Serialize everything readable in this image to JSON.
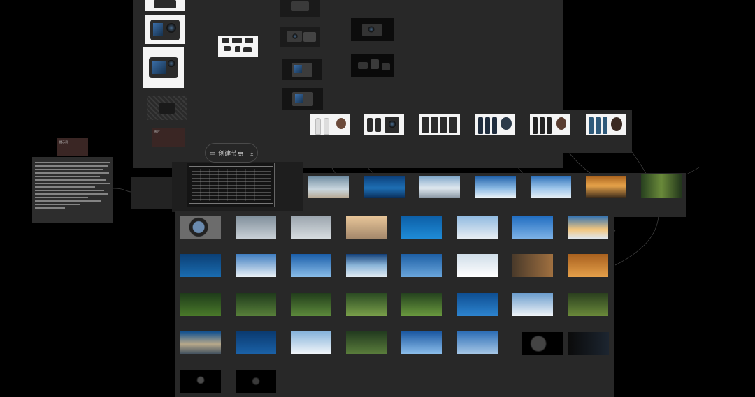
{
  "canvas": {
    "create_node_label": "创建节点",
    "create_node_icon": "node-add-icon",
    "download_icon": "download-icon",
    "note_label_1": "提示词",
    "note_label_2": "图片"
  },
  "gallery": {
    "rows": [
      [
        "camera-lens",
        "camera-stand",
        "camera-front",
        "camera-desert",
        "diver",
        "skier-goggles",
        "skydiver",
        "sunrise-clouds"
      ],
      [
        "diver-underwater",
        "skier-closeup",
        "skydiver-smile",
        "cloud-sea",
        "freefall",
        "snow-skier",
        "camera-duo",
        "desert-title"
      ],
      [
        "jungle-camera",
        "jungle-camera-2",
        "jungle-biker",
        "jungle-path",
        "jungle-title",
        "diver-blue",
        "mountain-snow",
        "jungle-rider"
      ],
      [
        "mountain-lake",
        "underwater-diver",
        "snowfield",
        "forest-person",
        "blue-sky",
        "skydivers",
        "camera-black",
        "camera-dark-title"
      ],
      [
        "logo-dark",
        "logo-dji"
      ]
    ]
  },
  "colors": {
    "background": "#000000",
    "panel": "#282828",
    "wire": "#5a5a5a",
    "note_label": "#3a2624"
  }
}
